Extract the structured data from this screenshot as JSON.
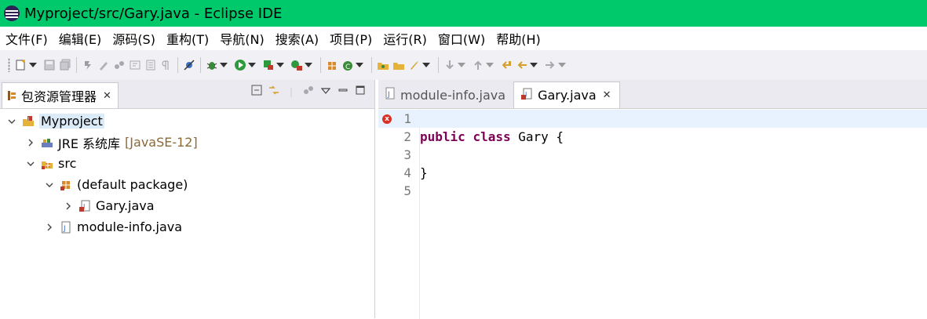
{
  "window": {
    "title": "Myproject/src/Gary.java - Eclipse IDE"
  },
  "menu": [
    "文件(F)",
    "编辑(E)",
    "源码(S)",
    "重构(T)",
    "导航(N)",
    "搜索(A)",
    "项目(P)",
    "运行(R)",
    "窗口(W)",
    "帮助(H)"
  ],
  "package_explorer": {
    "tab_label": "包资源管理器",
    "close_glyph": "✕",
    "tree": {
      "project": "Myproject",
      "jre": {
        "label": "JRE 系统库",
        "decorator": "[JavaSE-12]"
      },
      "src": "src",
      "default_package": "(default package)",
      "gary_file": "Gary.java",
      "module_info": "module-info.java"
    }
  },
  "editor": {
    "tabs": {
      "module_info": "module-info.java",
      "gary": "Gary.java",
      "close_glyph": "✕"
    },
    "line_numbers": {
      "l1": "1",
      "l2": "2",
      "l3": "3",
      "l4": "4",
      "l5": "5"
    },
    "code": {
      "line2": {
        "kw1": "public",
        "kw2": "class",
        "rest": " Gary {"
      },
      "line4": "}"
    },
    "error_marker_glyph": "x"
  },
  "colors": {
    "title_bar": "#00c96b",
    "keyword": "#7f0055",
    "current_line": "#e8f2fe"
  }
}
